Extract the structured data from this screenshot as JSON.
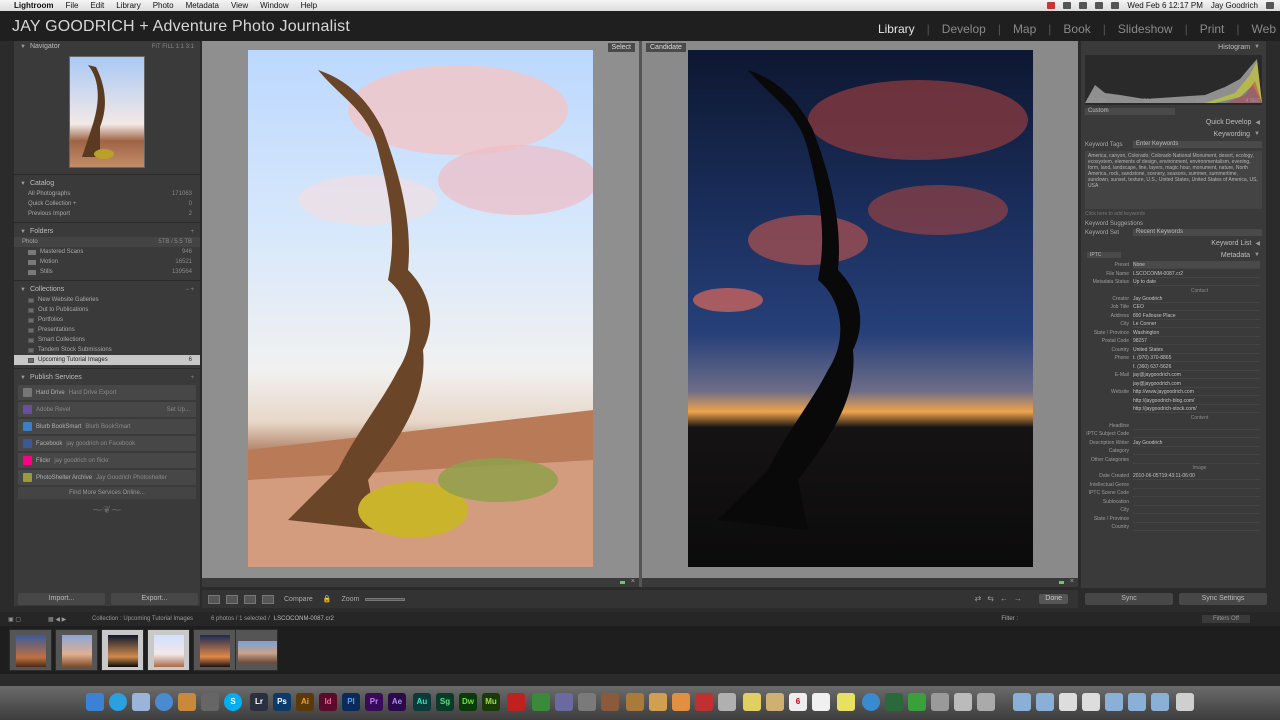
{
  "menubar": {
    "items": [
      "Lightroom",
      "File",
      "Edit",
      "Library",
      "Photo",
      "Metadata",
      "View",
      "Window",
      "Help"
    ],
    "clock": "Wed Feb 6  12:17 PM",
    "user": "Jay Goodrich"
  },
  "identity_plate": "JAY GOODRICH + Adventure Photo Journalist",
  "modules": [
    "Library",
    "Develop",
    "Map",
    "Book",
    "Slideshow",
    "Print",
    "Web"
  ],
  "left_panel": {
    "navigator": {
      "title": "Navigator",
      "zoom_options": "FIT  FILL  1:1  3:1"
    },
    "catalog": {
      "title": "Catalog",
      "items": [
        {
          "label": "All Photographs",
          "count": "171063"
        },
        {
          "label": "Quick Collection +",
          "count": "0"
        },
        {
          "label": "Previous Import",
          "count": "2"
        }
      ]
    },
    "folders": {
      "title": "Folders",
      "volume": {
        "label": "Photo",
        "count": "5TB / 5.5 TB"
      },
      "items": [
        {
          "label": "Mastered Scans",
          "count": "946"
        },
        {
          "label": "Motion",
          "count": "16521"
        },
        {
          "label": "Stills",
          "count": "139564"
        }
      ]
    },
    "collections": {
      "title": "Collections",
      "items": [
        {
          "label": "New Website Galleries"
        },
        {
          "label": "Out to Publications"
        },
        {
          "label": "Portfolios"
        },
        {
          "label": "Presentations"
        },
        {
          "label": "Smart Collections"
        },
        {
          "label": "Tandem Stock Submissions"
        },
        {
          "label": "Upcoming Tutorial Images",
          "count": "6"
        }
      ]
    },
    "publish": {
      "title": "Publish Services",
      "items": [
        {
          "label": "Hard Drive",
          "sub": "Hard Drive Export",
          "color": "#777777"
        },
        {
          "label": "Adobe Revel",
          "sub": "",
          "right": "Set Up...",
          "color": "#6a4fa0"
        },
        {
          "label": "Blurb BookSmart",
          "sub": "Blurb BookSmart",
          "color": "#3b7fc4"
        },
        {
          "label": "Facebook",
          "sub": "jay goodrich on Facebook",
          "color": "#3b5998"
        },
        {
          "label": "Flickr",
          "sub": "jay goodrich on flickr",
          "color": "#ff0084"
        },
        {
          "label": "PhotoShelter Archive",
          "sub": "Jay Goodrich Photoshelter",
          "color": "#9a9a3a"
        }
      ],
      "find_more": "Find More Services Online..."
    },
    "import_label": "Import...",
    "export_label": "Export..."
  },
  "compare": {
    "select_label": "Select",
    "candidate_label": "Candidate"
  },
  "toolbar": {
    "compare_label": "Compare",
    "zoom_label": "Zoom",
    "done_label": "Done"
  },
  "right_panel": {
    "histogram": {
      "title": "Histogram",
      "readout": [
        "ISO 100",
        "24 mm",
        "f / 22",
        "4 SEC"
      ]
    },
    "quick_develop": {
      "title": "Quick Develop",
      "preset": "Custom"
    },
    "keywording": {
      "title": "Keywording",
      "tags_label": "Keyword Tags",
      "tags_value": "Enter Keywords",
      "text": "America, canyon, Colorado, Colorado National Monument, desert, ecology, ecosystem, elements of design, environment, environmentalism, evening, form, land, landscape, line, layers, magic hour, monument, nature, North America, rock, sandstone, scenery, seasons, summer, summertime, sundown, sunset, texture, U.S., United States, United States of America, US, USA",
      "hint": "Click here to add keywords",
      "suggestions_label": "Keyword Suggestions",
      "set_label": "Keyword Set",
      "set_value": "Recent Keywords"
    },
    "keyword_list": {
      "title": "Keyword List"
    },
    "metadata": {
      "title": "Metadata",
      "mode": "IPTC",
      "preset_label": "Preset",
      "preset_value": "None",
      "rows": [
        {
          "k": "File Name",
          "v": "LSCOCONM-0087.cr2"
        },
        {
          "k": "Metadata Status",
          "v": "Up to date"
        },
        {
          "section": "Contact"
        },
        {
          "k": "Creator",
          "v": "Jay Goodrich"
        },
        {
          "k": "Job Title",
          "v": "CEO"
        },
        {
          "k": "Address",
          "v": "890 Fallouse Place"
        },
        {
          "k": "City",
          "v": "Le Conner"
        },
        {
          "k": "State / Province",
          "v": "Washington"
        },
        {
          "k": "Postal Code",
          "v": "98257"
        },
        {
          "k": "Country",
          "v": "United States"
        },
        {
          "k": "Phone",
          "v": "t. (970) 370-8865"
        },
        {
          "k": "",
          "v": "f. (360) 637-5626"
        },
        {
          "k": "E-Mail",
          "v": "jay@jaygoodrich.com"
        },
        {
          "k": "",
          "v": "jay@jaygoodrich.com"
        },
        {
          "k": "Website",
          "v": "http://www.jaygoodrich.com"
        },
        {
          "k": "",
          "v": "http://jaygoodrich-blog.com/"
        },
        {
          "k": "",
          "v": "http://jaygoodrich-stock.com/"
        },
        {
          "section": "Content"
        },
        {
          "k": "Headline",
          "v": ""
        },
        {
          "k": "IPTC Subject Code",
          "v": ""
        },
        {
          "k": "Description Writer",
          "v": "Jay Goodrich"
        },
        {
          "k": "Category",
          "v": ""
        },
        {
          "k": "Other Categories",
          "v": ""
        },
        {
          "section": "Image"
        },
        {
          "k": "Date Created",
          "v": "2010-06-05T19:43:11-06:00"
        },
        {
          "k": "Intellectual Genre",
          "v": ""
        },
        {
          "k": "IPTC Scene Code",
          "v": ""
        },
        {
          "k": "Sublocation",
          "v": ""
        },
        {
          "k": "City",
          "v": ""
        },
        {
          "k": "State / Province",
          "v": ""
        },
        {
          "k": "Country",
          "v": ""
        }
      ]
    },
    "sync_label": "Sync",
    "sync_settings_label": "Sync Settings"
  },
  "filmstrip": {
    "source": "Collection : Upcoming Tutorial Images",
    "count": "6 photos / 1 selected /",
    "filename": "LSCOCONM-0087.cr2",
    "filter_label": "Filter :",
    "filter_value": "Filters Off"
  }
}
